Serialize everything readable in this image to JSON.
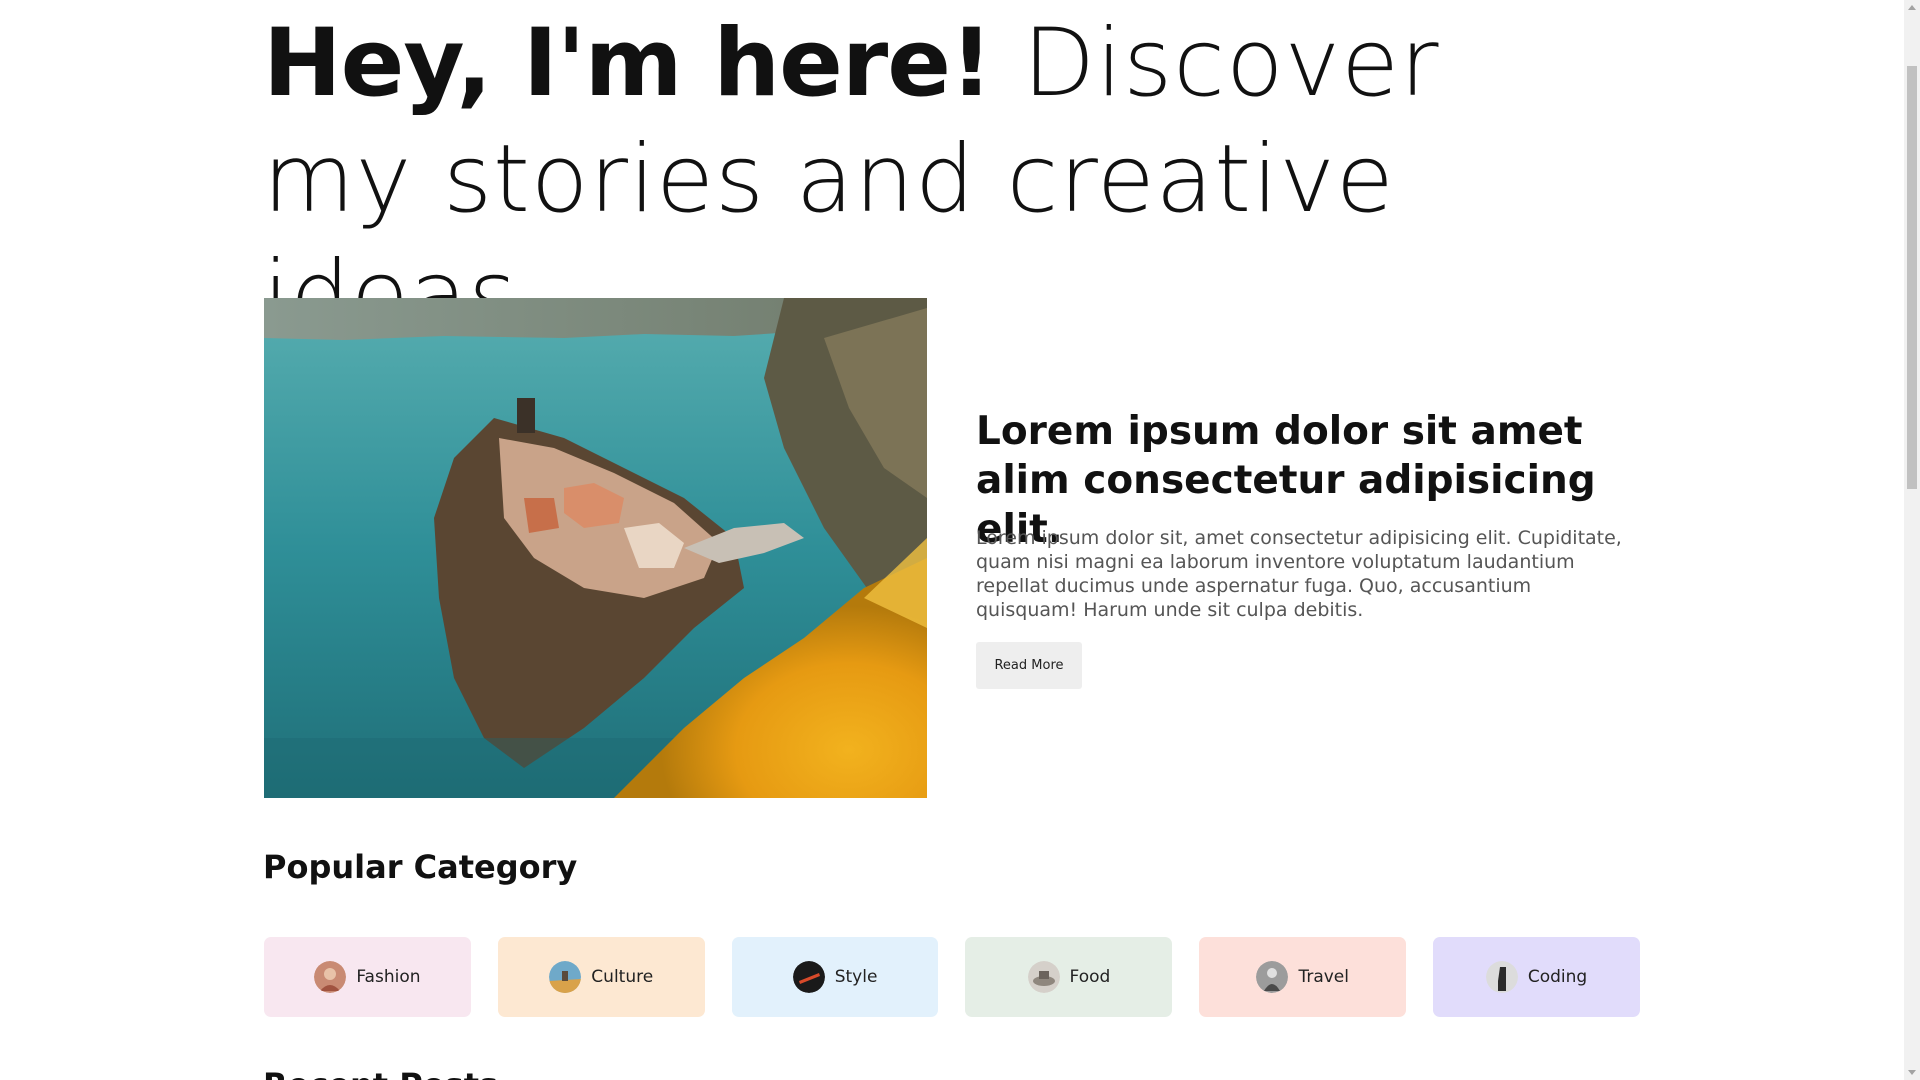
{
  "hero": {
    "title_bold": "Hey, I'm here!",
    "title_rest": " Discover my stories and creative ideas."
  },
  "featured_post": {
    "image_alt": "Coastal village on a cliff above turquoise sea with yellow flowers",
    "title": "Lorem ipsum dolor sit amet alim consectetur adipisicing elit.",
    "excerpt": "Lorem ipsum dolor sit, amet consectetur adipisicing elit. Cupiditate, quam nisi magni ea laborum inventore voluptatum laudantium repellat ducimus unde aspernatur fuga. Quo, accusantium quisquam! Harum unde sit culpa debitis.",
    "button_label": "Read More"
  },
  "popular_category": {
    "title": "Popular Category",
    "items": [
      {
        "label": "Fashion",
        "bg": "#f8e7f0",
        "thumb": "#c98a73"
      },
      {
        "label": "Culture",
        "bg": "#fde8d2",
        "thumb": "#d9a24a"
      },
      {
        "label": "Style",
        "bg": "#e2f1fc",
        "thumb": "#1a1a1a"
      },
      {
        "label": "Food",
        "bg": "#e5eee6",
        "thumb": "#b8b2ab"
      },
      {
        "label": "Travel",
        "bg": "#fde0da",
        "thumb": "#8c8c8c"
      },
      {
        "label": "Coding",
        "bg": "#e1dcfb",
        "thumb": "#d5d5d5"
      }
    ]
  },
  "recent_posts": {
    "title": "Recent Posts"
  }
}
